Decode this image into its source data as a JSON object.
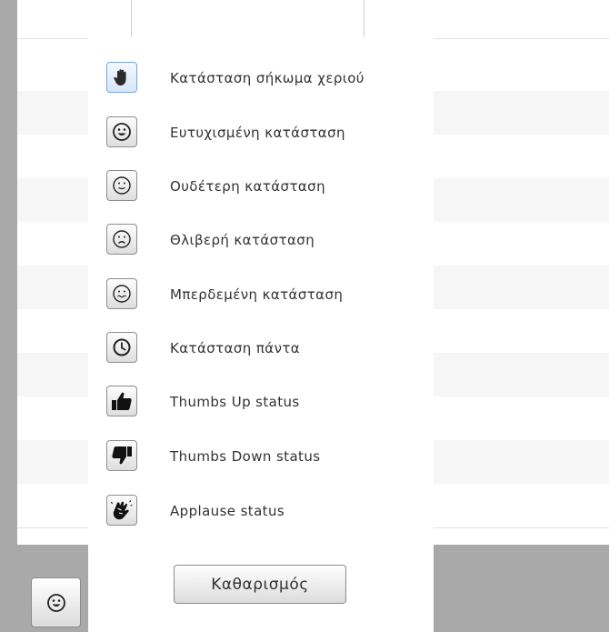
{
  "status_menu": {
    "items": [
      {
        "label": "Κατάσταση σήκωμα χεριού",
        "icon": "raise-hand-icon",
        "selected": true
      },
      {
        "label": "Ευτυχισμένη κατάσταση",
        "icon": "happy-face-icon",
        "selected": false
      },
      {
        "label": "Ουδέτερη κατάσταση",
        "icon": "neutral-face-icon",
        "selected": false
      },
      {
        "label": "Θλιβερή κατάσταση",
        "icon": "sad-face-icon",
        "selected": false
      },
      {
        "label": "Μπερδεμένη κατάσταση",
        "icon": "confused-face-icon",
        "selected": false
      },
      {
        "label": "Κατάσταση πάντα",
        "icon": "clock-icon",
        "selected": false
      },
      {
        "label": "Thumbs Up status",
        "icon": "thumbs-up-icon",
        "selected": false
      },
      {
        "label": "Thumbs Down status",
        "icon": "thumbs-down-icon",
        "selected": false
      },
      {
        "label": "Applause status",
        "icon": "applause-icon",
        "selected": false
      }
    ],
    "clear_label": "Καθαρισμός"
  },
  "status_toggle": {
    "icon": "happy-face-icon"
  },
  "colors": {
    "selected_border": "#7aa6d6",
    "text": "#333333",
    "backdrop": "#a9a9a9"
  }
}
